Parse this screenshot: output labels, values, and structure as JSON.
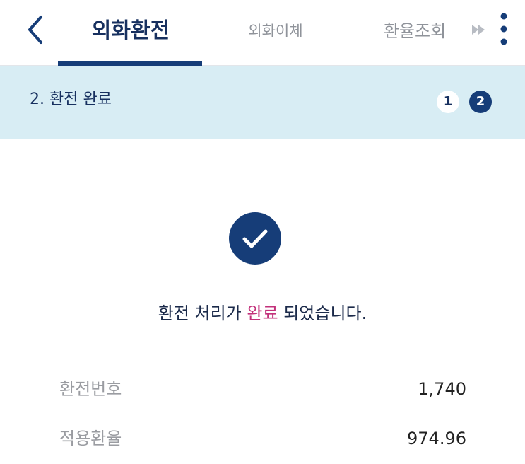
{
  "header": {
    "tabs": [
      {
        "label": "외화환전",
        "active": true
      },
      {
        "label": "외화이체",
        "active": false
      },
      {
        "label": "환율조회",
        "active": false
      }
    ],
    "icons": {
      "back": "chevron-left-icon",
      "more_tabs": "double-chevron-right-icon",
      "menu": "kebab-menu-icon"
    }
  },
  "step_bar": {
    "title": "2. 환전 완료",
    "steps": [
      "1",
      "2"
    ],
    "current_step": 2
  },
  "completion": {
    "icon": "checkmark-circle-icon",
    "message_prefix": "환전 처리가",
    "message_highlight": "완료",
    "message_suffix": "되었습니다."
  },
  "details": [
    {
      "label": "환전번호",
      "value": "1,740"
    },
    {
      "label": "적용환율",
      "value": "974.96"
    }
  ],
  "colors": {
    "primary_navy": "#163d78",
    "step_bar_background": "#d8edf4",
    "highlight_pink": "#c2307a",
    "inactive_tab_gray": "#8f939a"
  }
}
